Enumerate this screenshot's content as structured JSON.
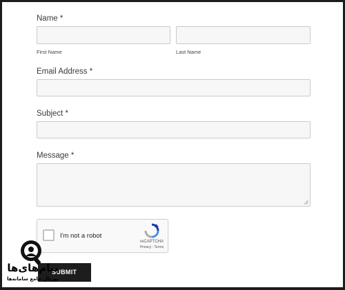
{
  "form": {
    "name": {
      "label": "Name *",
      "first_sub": "First Name",
      "last_sub": "Last Name"
    },
    "email": {
      "label": "Email Address *"
    },
    "subject": {
      "label": "Subject *"
    },
    "message": {
      "label": "Message *"
    },
    "submit_label": "SUBMIT"
  },
  "captcha": {
    "text": "I'm not a robot",
    "brand": "reCAPTCHA",
    "terms": "Privacy - Terms"
  },
  "watermark": {
    "title": "پیام‌های‌ها",
    "subtitle": "پورتال جامع سامانه‌ها"
  },
  "colors": {
    "border": "#1c1c1c",
    "field_bg": "#f7f7f7",
    "button_bg": "#1d1d1d"
  }
}
